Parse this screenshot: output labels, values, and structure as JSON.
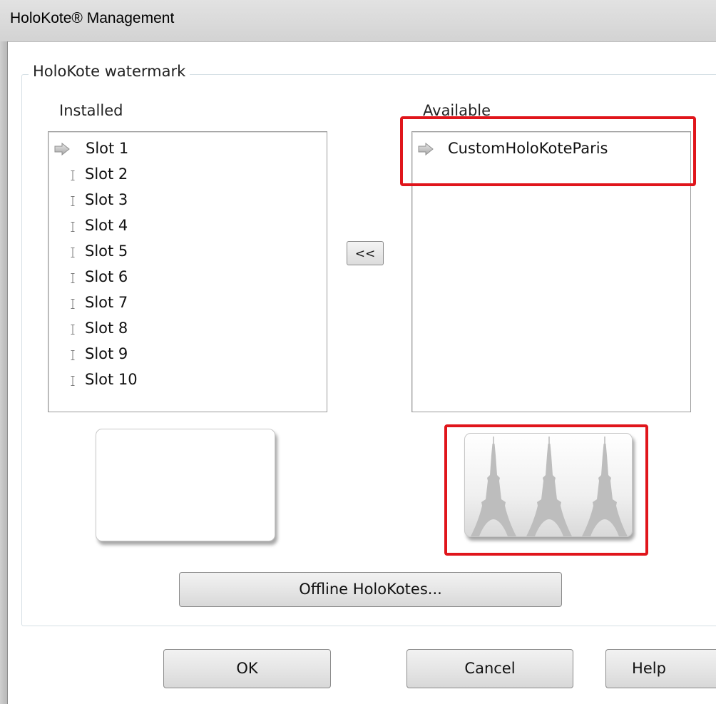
{
  "window": {
    "title": "HoloKote® Management"
  },
  "group": {
    "legend": "HoloKote watermark"
  },
  "installed": {
    "label": "Installed",
    "items": [
      "Slot 1",
      "Slot 2",
      "Slot 3",
      "Slot 4",
      "Slot 5",
      "Slot 6",
      "Slot 7",
      "Slot 8",
      "Slot 9",
      "Slot 10"
    ],
    "selected_index": 0
  },
  "available": {
    "label": "Available",
    "items": [
      "CustomHoloKoteParis"
    ],
    "selected_index": 0
  },
  "transfer_button": {
    "label": "<<"
  },
  "offline_button": {
    "label": "Offline HoloKotes..."
  },
  "dialog_buttons": {
    "ok": "OK",
    "cancel": "Cancel",
    "help": "Help"
  },
  "colors": {
    "highlight": "#e0151b",
    "preview_tower": "#bdbdbd"
  },
  "icons": {
    "selected_marker": "arrow-right-icon",
    "slot_marker": "ibeam-icon",
    "preview": "eiffel-tower-icon"
  }
}
